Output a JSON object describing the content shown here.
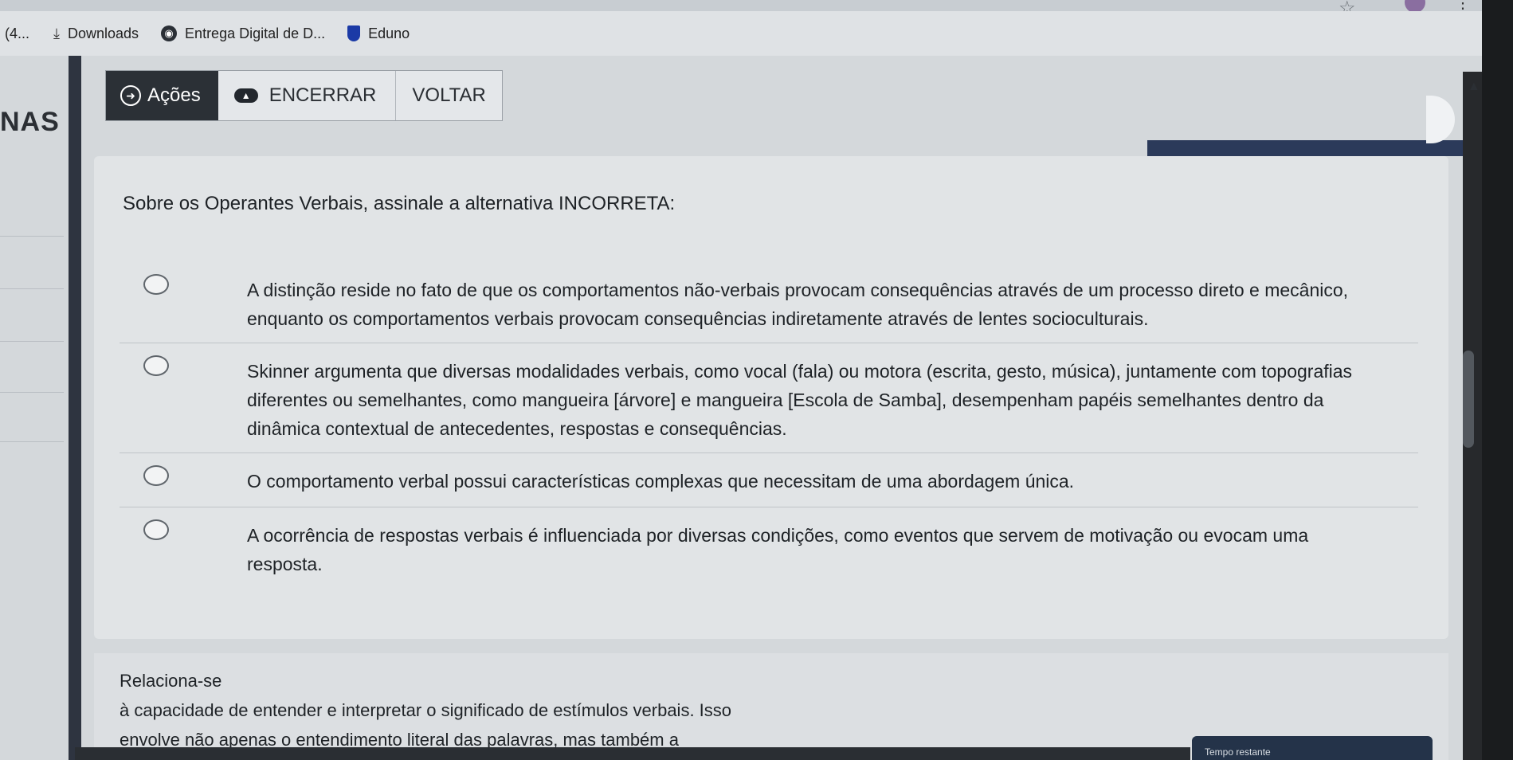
{
  "bookmarks": [
    {
      "label": "(4...",
      "icon": "tab-icon"
    },
    {
      "label": "Downloads",
      "icon": "download-icon"
    },
    {
      "label": "Entrega Digital de D...",
      "icon": "globe-icon"
    },
    {
      "label": "Eduno",
      "icon": "eduno-icon"
    }
  ],
  "page": {
    "side_heading": "NAS"
  },
  "toolbar": {
    "acoes_label": "Ações",
    "encerrar_label": "ENCERRAR",
    "voltar_label": "VOLTAR"
  },
  "question": {
    "prompt": "Sobre os Operantes Verbais, assinale a alternativa INCORRETA:",
    "options": [
      {
        "text": "A distinção reside no fato de que os comportamentos não-verbais provocam consequências através de um processo direto e mecânico, enquanto os comportamentos verbais provocam consequências indiretamente através de lentes socioculturais."
      },
      {
        "text": "Skinner argumenta que diversas modalidades verbais, como vocal (fala) ou motora (escrita, gesto, música), juntamente com topografias diferentes ou semelhantes, como mangueira [árvore] e mangueira [Escola de Samba], desempenham papéis semelhantes dentro da dinâmica contextual de antecedentes, respostas e consequências."
      },
      {
        "text": "O comportamento verbal possui características complexas que necessitam de uma abordagem única."
      },
      {
        "text": "A ocorrência de respostas verbais é influenciada por diversas condições, como eventos que servem de motivação ou evocam uma resposta."
      }
    ]
  },
  "next_block": {
    "line1": "Relaciona-se",
    "line2": "à capacidade de entender e interpretar o significado de estímulos verbais. Isso",
    "line3": "envolve não apenas o entendimento literal das palavras, mas também a"
  },
  "timer": {
    "label": "Tempo restante"
  },
  "colors": {
    "toolbar_dark": "#2b3036",
    "accent_navy": "#243349"
  }
}
